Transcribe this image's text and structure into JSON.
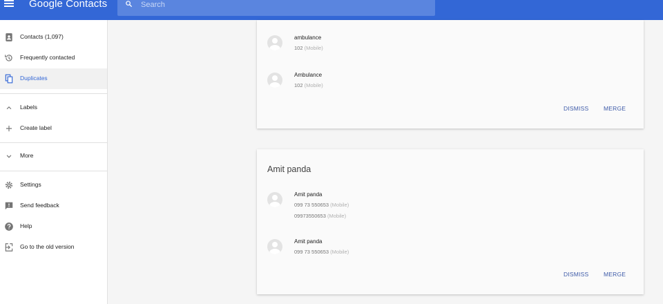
{
  "app": {
    "title": "Google Contacts"
  },
  "search": {
    "placeholder": "Search"
  },
  "sidebar": {
    "items": [
      {
        "label": "Contacts (1,097)",
        "icon": "contacts-icon"
      },
      {
        "label": "Frequently contacted",
        "icon": "history-icon"
      },
      {
        "label": "Duplicates",
        "icon": "duplicates-icon",
        "active": true
      },
      {
        "label": "Labels",
        "icon": "chevron-up-icon"
      },
      {
        "label": "Create label",
        "icon": "plus-icon"
      },
      {
        "label": "More",
        "icon": "chevron-down-icon"
      },
      {
        "label": "Settings",
        "icon": "gear-icon"
      },
      {
        "label": "Send feedback",
        "icon": "feedback-icon"
      },
      {
        "label": "Help",
        "icon": "help-icon"
      },
      {
        "label": "Go to the old version",
        "icon": "exit-icon"
      }
    ]
  },
  "cards": [
    {
      "title": "",
      "contacts": [
        {
          "name": "ambulance",
          "phones": [
            {
              "number": "102",
              "type": "(Mobile)"
            }
          ]
        },
        {
          "name": "Ambulance",
          "phones": [
            {
              "number": "102",
              "type": "(Mobile)"
            }
          ]
        }
      ],
      "dismiss": "DISMISS",
      "merge": "MERGE"
    },
    {
      "title": "Amit panda",
      "contacts": [
        {
          "name": "Amit panda",
          "phones": [
            {
              "number": "099 73 550653",
              "type": "(Mobile)"
            },
            {
              "number": "09973550653",
              "type": "(Mobile)"
            }
          ]
        },
        {
          "name": "Amit panda",
          "phones": [
            {
              "number": "099 73 550653",
              "type": "(Mobile)"
            }
          ]
        }
      ],
      "dismiss": "DISMISS",
      "merge": "MERGE"
    }
  ],
  "colors": {
    "topbar": "#3367d6",
    "search_bg": "#5a85df",
    "accent": "#3367d6",
    "button_text": "#3d5aa8"
  }
}
